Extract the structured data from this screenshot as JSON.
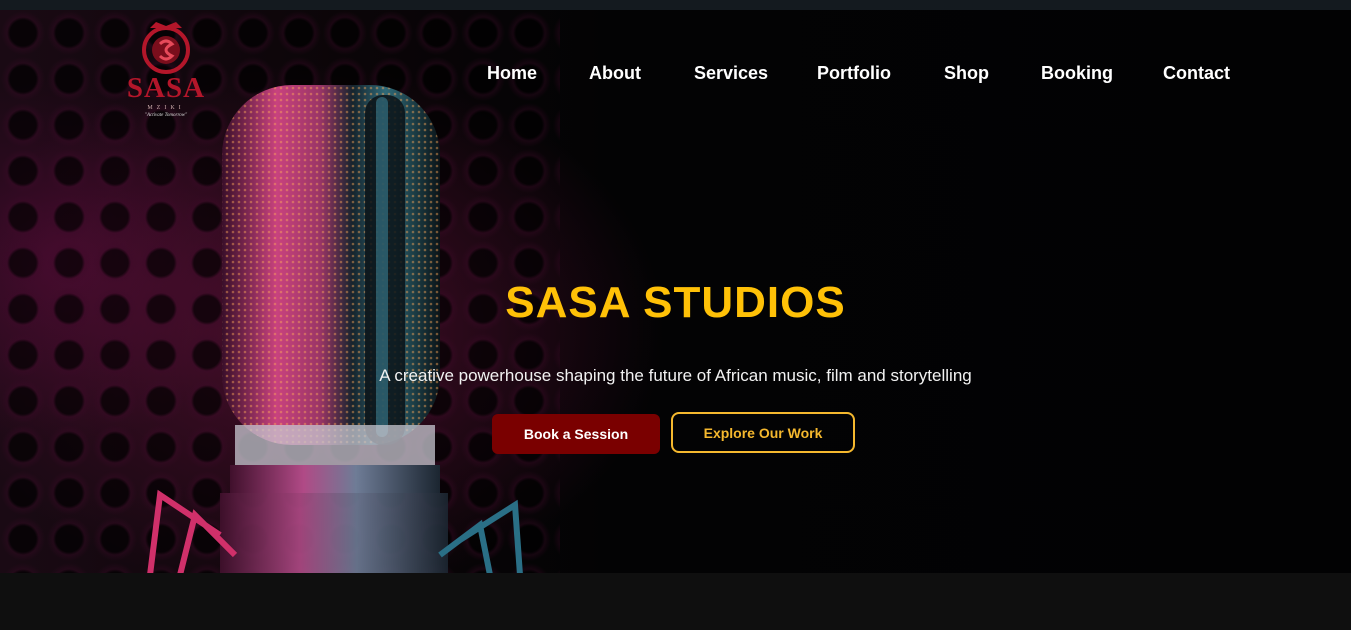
{
  "brand": {
    "name": "SASA",
    "sub": "MZIKI",
    "tagline": "\"Activate Tomorrow\""
  },
  "nav": {
    "items": [
      {
        "label": "Home"
      },
      {
        "label": "About"
      },
      {
        "label": "Services"
      },
      {
        "label": "Portfolio"
      },
      {
        "label": "Shop"
      },
      {
        "label": "Booking"
      },
      {
        "label": "Contact"
      }
    ]
  },
  "hero": {
    "title": "SASA STUDIOS",
    "subtitle": "A creative powerhouse shaping the future of African music, film and storytelling",
    "primary_button": "Book a Session",
    "secondary_button": "Explore Our Work"
  },
  "colors": {
    "accent": "#ffc107",
    "primary_button_bg": "#7a0000",
    "secondary_button_border": "#f5b82e",
    "logo_red": "#b3162a"
  },
  "icons": {
    "logo": "sasa-crest-logo-icon",
    "hero_image": "studio-microphone-image"
  }
}
